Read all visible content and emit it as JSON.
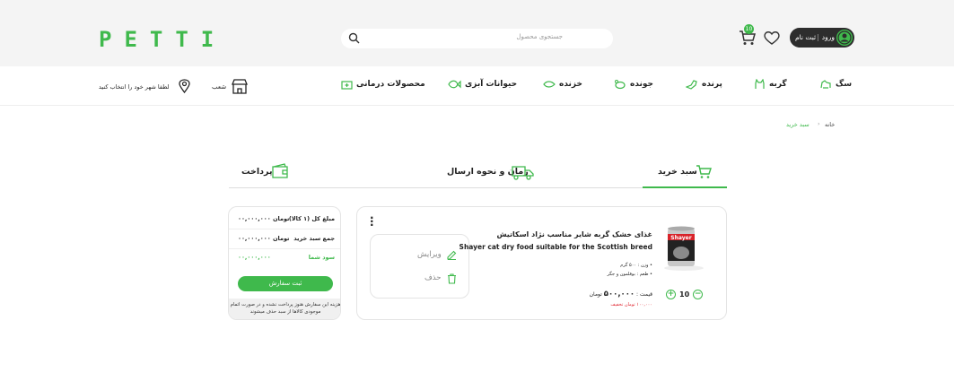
{
  "header": {
    "logo": "PETTI",
    "search_placeholder": "جستجوی محصول",
    "login_label": "ورود",
    "login_sep": "|",
    "register_label": "ثبت نام",
    "cart_count": "10"
  },
  "nav": {
    "items": [
      {
        "label": "سگ"
      },
      {
        "label": "گربه"
      },
      {
        "label": "پرنده"
      },
      {
        "label": "جونده"
      },
      {
        "label": "خزنده"
      },
      {
        "label": "حیوانات آبزی"
      },
      {
        "label": "محصولات درمانی"
      }
    ],
    "branches_label": "شعب",
    "city_label": "لطفا شهر خود را انتخاب کنید"
  },
  "breadcrumb": {
    "home": "خانه",
    "sep": "›",
    "current": "سبد خرید"
  },
  "steps": {
    "cart": "سبد خرید",
    "shipping": "زمان و نحوه ارسال",
    "payment": "پرداخت"
  },
  "product": {
    "title_fa": "غذای خشک گربه شایر مناسب نژاد اسکاتیش",
    "title_en": "Shayer cat dry food suitable for the Scottish breed",
    "weight": "• وزن : ۵۰۰ گرم",
    "flavor": "• طعم : بوقلمون و جگر",
    "price_label": "قیمت :",
    "price_value": "۵۰۰,۰۰۰",
    "price_unit": "تومان",
    "discount": "۱۰۰,۰۰۰ تومان تخفیف",
    "quantity": "10",
    "can_brand": "Shayer",
    "edit_label": "ویرایش",
    "delete_label": "حذف"
  },
  "summary": {
    "total_label": "مبلغ کل (۱ کالا)",
    "total_value": "۰۰,۰۰۰,۰۰۰ تومان",
    "cart_sum_label": "جمع سبد خرید",
    "cart_sum_value": "۰۰,۰۰۰,۰۰۰ تومان",
    "profit_label": "سود شما",
    "profit_value": "۰۰,۰۰۰,۰۰۰",
    "submit_label": "ثبت سفارش",
    "note": "هزینه این سفارش هنوز پرداخت نشده و در صورت اتمام موجودی کالاها از سبد حذف میشوند"
  },
  "colors": {
    "accent": "#3fb94c",
    "dark": "#2d2d2d",
    "discount": "#e0252f"
  }
}
